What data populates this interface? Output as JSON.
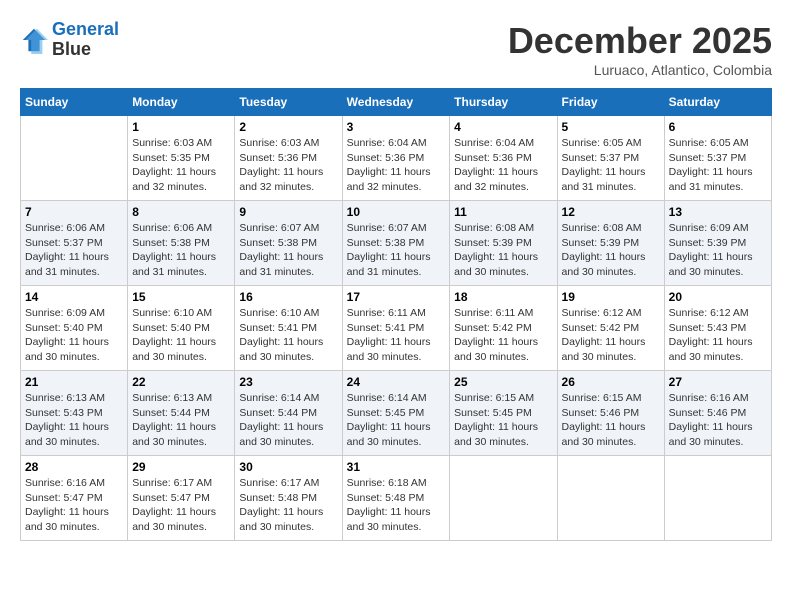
{
  "logo": {
    "line1": "General",
    "line2": "Blue"
  },
  "header": {
    "title": "December 2025",
    "subtitle": "Luruaco, Atlantico, Colombia"
  },
  "weekdays": [
    "Sunday",
    "Monday",
    "Tuesday",
    "Wednesday",
    "Thursday",
    "Friday",
    "Saturday"
  ],
  "weeks": [
    [
      {
        "day": "",
        "sunrise": "",
        "sunset": "",
        "daylight": ""
      },
      {
        "day": "1",
        "sunrise": "Sunrise: 6:03 AM",
        "sunset": "Sunset: 5:35 PM",
        "daylight": "Daylight: 11 hours and 32 minutes."
      },
      {
        "day": "2",
        "sunrise": "Sunrise: 6:03 AM",
        "sunset": "Sunset: 5:36 PM",
        "daylight": "Daylight: 11 hours and 32 minutes."
      },
      {
        "day": "3",
        "sunrise": "Sunrise: 6:04 AM",
        "sunset": "Sunset: 5:36 PM",
        "daylight": "Daylight: 11 hours and 32 minutes."
      },
      {
        "day": "4",
        "sunrise": "Sunrise: 6:04 AM",
        "sunset": "Sunset: 5:36 PM",
        "daylight": "Daylight: 11 hours and 32 minutes."
      },
      {
        "day": "5",
        "sunrise": "Sunrise: 6:05 AM",
        "sunset": "Sunset: 5:37 PM",
        "daylight": "Daylight: 11 hours and 31 minutes."
      },
      {
        "day": "6",
        "sunrise": "Sunrise: 6:05 AM",
        "sunset": "Sunset: 5:37 PM",
        "daylight": "Daylight: 11 hours and 31 minutes."
      }
    ],
    [
      {
        "day": "7",
        "sunrise": "Sunrise: 6:06 AM",
        "sunset": "Sunset: 5:37 PM",
        "daylight": "Daylight: 11 hours and 31 minutes."
      },
      {
        "day": "8",
        "sunrise": "Sunrise: 6:06 AM",
        "sunset": "Sunset: 5:38 PM",
        "daylight": "Daylight: 11 hours and 31 minutes."
      },
      {
        "day": "9",
        "sunrise": "Sunrise: 6:07 AM",
        "sunset": "Sunset: 5:38 PM",
        "daylight": "Daylight: 11 hours and 31 minutes."
      },
      {
        "day": "10",
        "sunrise": "Sunrise: 6:07 AM",
        "sunset": "Sunset: 5:38 PM",
        "daylight": "Daylight: 11 hours and 31 minutes."
      },
      {
        "day": "11",
        "sunrise": "Sunrise: 6:08 AM",
        "sunset": "Sunset: 5:39 PM",
        "daylight": "Daylight: 11 hours and 30 minutes."
      },
      {
        "day": "12",
        "sunrise": "Sunrise: 6:08 AM",
        "sunset": "Sunset: 5:39 PM",
        "daylight": "Daylight: 11 hours and 30 minutes."
      },
      {
        "day": "13",
        "sunrise": "Sunrise: 6:09 AM",
        "sunset": "Sunset: 5:39 PM",
        "daylight": "Daylight: 11 hours and 30 minutes."
      }
    ],
    [
      {
        "day": "14",
        "sunrise": "Sunrise: 6:09 AM",
        "sunset": "Sunset: 5:40 PM",
        "daylight": "Daylight: 11 hours and 30 minutes."
      },
      {
        "day": "15",
        "sunrise": "Sunrise: 6:10 AM",
        "sunset": "Sunset: 5:40 PM",
        "daylight": "Daylight: 11 hours and 30 minutes."
      },
      {
        "day": "16",
        "sunrise": "Sunrise: 6:10 AM",
        "sunset": "Sunset: 5:41 PM",
        "daylight": "Daylight: 11 hours and 30 minutes."
      },
      {
        "day": "17",
        "sunrise": "Sunrise: 6:11 AM",
        "sunset": "Sunset: 5:41 PM",
        "daylight": "Daylight: 11 hours and 30 minutes."
      },
      {
        "day": "18",
        "sunrise": "Sunrise: 6:11 AM",
        "sunset": "Sunset: 5:42 PM",
        "daylight": "Daylight: 11 hours and 30 minutes."
      },
      {
        "day": "19",
        "sunrise": "Sunrise: 6:12 AM",
        "sunset": "Sunset: 5:42 PM",
        "daylight": "Daylight: 11 hours and 30 minutes."
      },
      {
        "day": "20",
        "sunrise": "Sunrise: 6:12 AM",
        "sunset": "Sunset: 5:43 PM",
        "daylight": "Daylight: 11 hours and 30 minutes."
      }
    ],
    [
      {
        "day": "21",
        "sunrise": "Sunrise: 6:13 AM",
        "sunset": "Sunset: 5:43 PM",
        "daylight": "Daylight: 11 hours and 30 minutes."
      },
      {
        "day": "22",
        "sunrise": "Sunrise: 6:13 AM",
        "sunset": "Sunset: 5:44 PM",
        "daylight": "Daylight: 11 hours and 30 minutes."
      },
      {
        "day": "23",
        "sunrise": "Sunrise: 6:14 AM",
        "sunset": "Sunset: 5:44 PM",
        "daylight": "Daylight: 11 hours and 30 minutes."
      },
      {
        "day": "24",
        "sunrise": "Sunrise: 6:14 AM",
        "sunset": "Sunset: 5:45 PM",
        "daylight": "Daylight: 11 hours and 30 minutes."
      },
      {
        "day": "25",
        "sunrise": "Sunrise: 6:15 AM",
        "sunset": "Sunset: 5:45 PM",
        "daylight": "Daylight: 11 hours and 30 minutes."
      },
      {
        "day": "26",
        "sunrise": "Sunrise: 6:15 AM",
        "sunset": "Sunset: 5:46 PM",
        "daylight": "Daylight: 11 hours and 30 minutes."
      },
      {
        "day": "27",
        "sunrise": "Sunrise: 6:16 AM",
        "sunset": "Sunset: 5:46 PM",
        "daylight": "Daylight: 11 hours and 30 minutes."
      }
    ],
    [
      {
        "day": "28",
        "sunrise": "Sunrise: 6:16 AM",
        "sunset": "Sunset: 5:47 PM",
        "daylight": "Daylight: 11 hours and 30 minutes."
      },
      {
        "day": "29",
        "sunrise": "Sunrise: 6:17 AM",
        "sunset": "Sunset: 5:47 PM",
        "daylight": "Daylight: 11 hours and 30 minutes."
      },
      {
        "day": "30",
        "sunrise": "Sunrise: 6:17 AM",
        "sunset": "Sunset: 5:48 PM",
        "daylight": "Daylight: 11 hours and 30 minutes."
      },
      {
        "day": "31",
        "sunrise": "Sunrise: 6:18 AM",
        "sunset": "Sunset: 5:48 PM",
        "daylight": "Daylight: 11 hours and 30 minutes."
      },
      {
        "day": "",
        "sunrise": "",
        "sunset": "",
        "daylight": ""
      },
      {
        "day": "",
        "sunrise": "",
        "sunset": "",
        "daylight": ""
      },
      {
        "day": "",
        "sunrise": "",
        "sunset": "",
        "daylight": ""
      }
    ]
  ]
}
